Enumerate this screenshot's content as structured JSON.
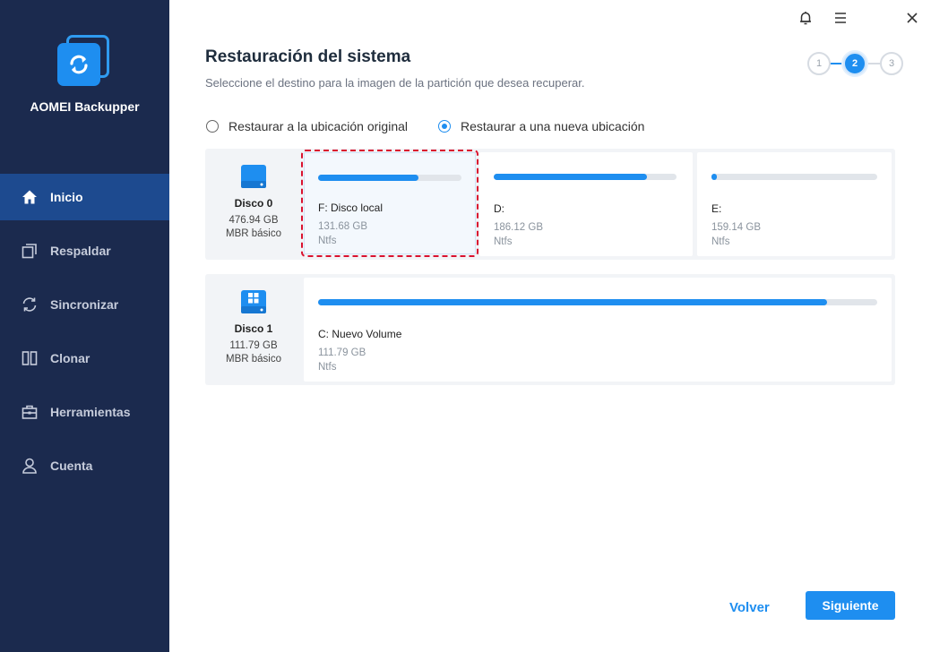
{
  "app": {
    "name": "AOMEI Backupper"
  },
  "sidebar": {
    "items": [
      {
        "label": "Inicio",
        "icon": "home-icon",
        "active": true
      },
      {
        "label": "Respaldar",
        "icon": "backup-icon",
        "active": false
      },
      {
        "label": "Sincronizar",
        "icon": "sync-icon",
        "active": false
      },
      {
        "label": "Clonar",
        "icon": "clone-icon",
        "active": false
      },
      {
        "label": "Herramientas",
        "icon": "toolbox-icon",
        "active": false
      },
      {
        "label": "Cuenta",
        "icon": "user-icon",
        "active": false
      }
    ]
  },
  "window_controls": [
    "bell-icon",
    "menu-icon",
    "close-icon"
  ],
  "header": {
    "title": "Restauración del sistema",
    "subtitle": "Seleccione el destino para la imagen de la partición que desea recuperar."
  },
  "steps": [
    {
      "label": "1",
      "active": false
    },
    {
      "label": "2",
      "active": true
    },
    {
      "label": "3",
      "active": false
    }
  ],
  "options": {
    "original": {
      "label": "Restaurar a la ubicación original",
      "selected": false
    },
    "new": {
      "label": "Restaurar a una nueva ubicación",
      "selected": true
    }
  },
  "disks": [
    {
      "name": "Disco 0",
      "size": "476.94 GB",
      "type": "MBR básico",
      "partitions": [
        {
          "name": "F: Disco local",
          "size": "131.68 GB",
          "fs": "Ntfs",
          "used_fraction": 0.7,
          "selected": true
        },
        {
          "name": "D:",
          "size": "186.12 GB",
          "fs": "Ntfs",
          "used_fraction": 0.84,
          "selected": false
        },
        {
          "name": "E:",
          "size": "159.14 GB",
          "fs": "Ntfs",
          "used_fraction": 0.02,
          "selected": false
        }
      ]
    },
    {
      "name": "Disco 1",
      "size": "111.79 GB",
      "type": "MBR básico",
      "partitions": [
        {
          "name": "C: Nuevo Volume",
          "size": "111.79 GB",
          "fs": "Ntfs",
          "used_fraction": 0.91,
          "selected": false
        }
      ]
    }
  ],
  "footer": {
    "back_label": "Volver",
    "next_label": "Siguiente"
  },
  "colors": {
    "accent": "#1e8ef0",
    "sidebar": "#1b2a4e",
    "selection_border": "#d9122f"
  }
}
